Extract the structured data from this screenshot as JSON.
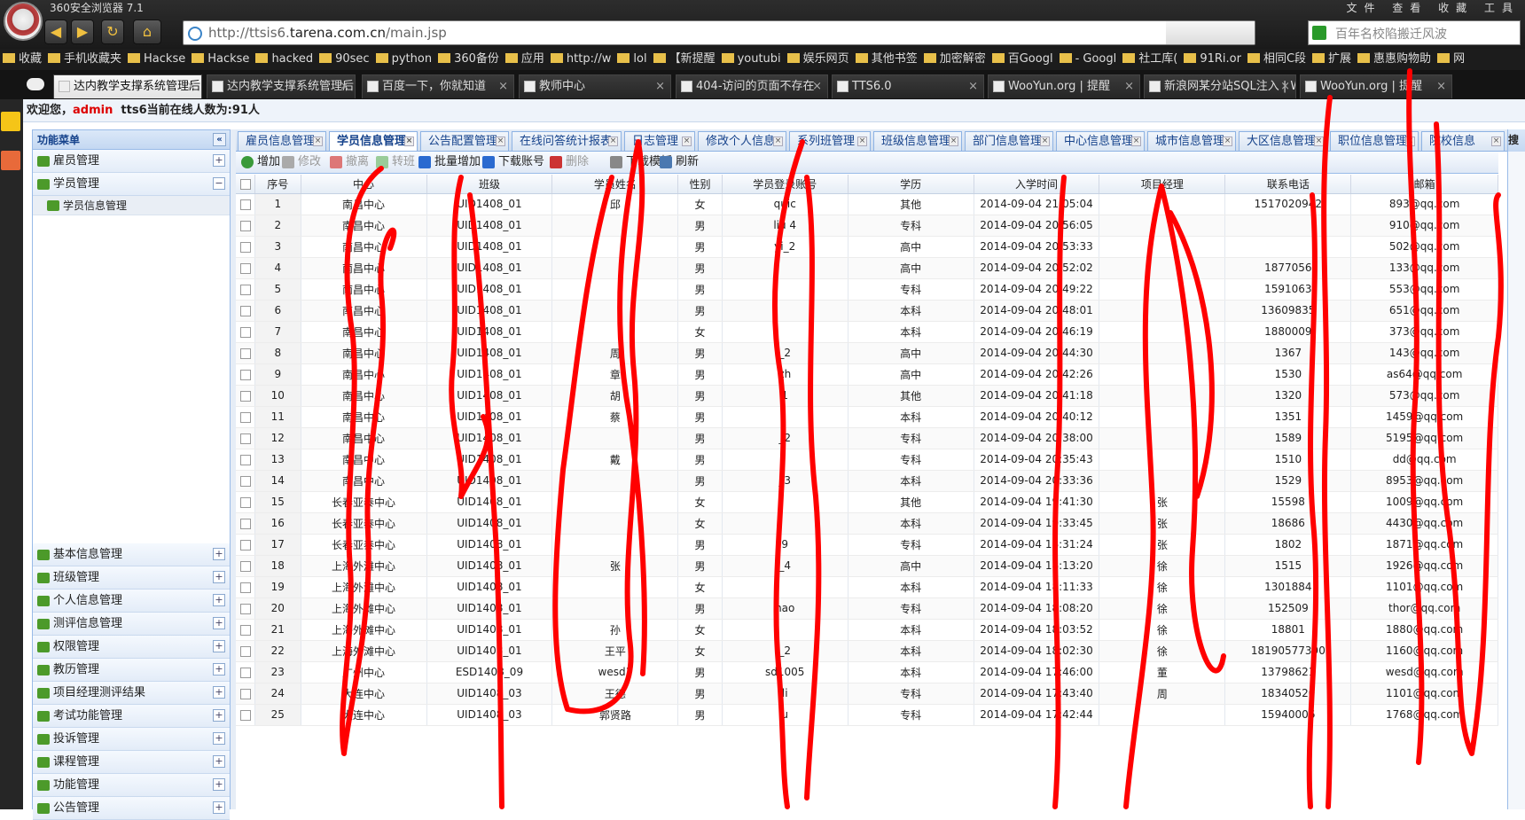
{
  "browser": {
    "title": "360安全浏览器 7.1",
    "menus": [
      "文件",
      "查看",
      "收藏",
      "工具"
    ],
    "url_prefix": "http://ttsis6.",
    "url_domain": "tarena.com.cn",
    "url_suffix": "/main.jsp",
    "search_placeholder": "百年名校陷搬迁风波"
  },
  "bookmarks": [
    "收藏",
    "手机收藏夹",
    "Hackse",
    "Hackse",
    "hacked",
    "90sec",
    "python",
    "360备份",
    "应用",
    "http://w",
    "lol",
    "【新提醒",
    "youtubi",
    "娱乐网页",
    "其他书签",
    "加密解密",
    "百Googl",
    "- Googl",
    "社工库(",
    "91Ri.or",
    "相同C段",
    "扩展",
    "惠惠购物助",
    "网"
  ],
  "tabs": [
    {
      "label": "达内教学支撑系统管理后台"
    },
    {
      "label": "达内教学支撑系统管理后台"
    },
    {
      "label": "百度一下，你就知道"
    },
    {
      "label": "教师中心"
    },
    {
      "label": "404-访问的页面不存在"
    },
    {
      "label": "TTS6.0"
    },
    {
      "label": "WooYun.org | 提醒"
    },
    {
      "label": "新浪网某分站SQL注入 | W"
    },
    {
      "label": "WooYun.org | 提醒"
    }
  ],
  "welcome": {
    "prefix": "欢迎您，",
    "user": "admin",
    "suffix": "tts6当前在线人数为:91人"
  },
  "sidebar": {
    "title": "功能菜单",
    "groups_top": [
      "雇员管理",
      "学员管理"
    ],
    "sub_item": "学员信息管理",
    "groups": [
      "基本信息管理",
      "班级管理",
      "个人信息管理",
      "测评信息管理",
      "权限管理",
      "教历管理",
      "项目经理测评结果",
      "考试功能管理",
      "投诉管理",
      "课程管理",
      "功能管理",
      "公告管理"
    ]
  },
  "page_tabs": [
    "雇员信息管理",
    "学员信息管理",
    "公告配置管理",
    "在线问答统计报表",
    "日志管理",
    "修改个人信息",
    "系列班管理",
    "班级信息管理",
    "部门信息管理",
    "中心信息管理",
    "城市信息管理",
    "大区信息管理",
    "职位信息管理",
    "院校信息"
  ],
  "toolbar": [
    "增加",
    "修改",
    "撤离",
    "转班",
    "批量增加",
    "下载账号",
    "删除",
    "下载模板",
    "刷新"
  ],
  "right_panel_title": "搜",
  "table": {
    "headers": [
      "序号",
      "中心",
      "班级",
      "学员姓名",
      "性别",
      "学员登录账号",
      "学历",
      "入学时间",
      "项目经理",
      "联系电话",
      "邮箱"
    ],
    "rows": [
      [
        "1",
        "南昌中心",
        "UID1408_01",
        "邱",
        "女",
        "quic",
        "其他",
        "2014-09-04 21:05:04",
        "",
        "1517020942",
        "893@qq.com"
      ],
      [
        "2",
        "南昌中心",
        "UID1408_01",
        "",
        "男",
        "liu 4",
        "专科",
        "2014-09-04 20:56:05",
        "",
        "",
        "910@qq.com"
      ],
      [
        "3",
        "南昌中心",
        "UID1408_01",
        "",
        "男",
        "yi_2",
        "高中",
        "2014-09-04 20:53:33",
        "",
        "",
        "502@qq.com"
      ],
      [
        "4",
        "南昌中心",
        "UID1408_01",
        "",
        "男",
        "",
        "高中",
        "2014-09-04 20:52:02",
        "",
        "1877056",
        "133@qq.com"
      ],
      [
        "5",
        "南昌中心",
        "UID1408_01",
        "",
        "男",
        "",
        "专科",
        "2014-09-04 20:49:22",
        "",
        "1591063",
        "553@qq.com"
      ],
      [
        "6",
        "南昌中心",
        "UID1408_01",
        "",
        "男",
        "",
        "本科",
        "2014-09-04 20:48:01",
        "",
        "13609835",
        "651@qq.com"
      ],
      [
        "7",
        "南昌中心",
        "UID1408_01",
        "",
        "女",
        "",
        "本科",
        "2014-09-04 20:46:19",
        "",
        "1880009",
        "373@qq.com"
      ],
      [
        "8",
        "南昌中心",
        "UID1408_01",
        "周",
        "男",
        "_2",
        "高中",
        "2014-09-04 20:44:30",
        "",
        "1367",
        "143@qq.com"
      ],
      [
        "9",
        "南昌中心",
        "UID1408_01",
        "章",
        "男",
        "zh",
        "高中",
        "2014-09-04 20:42:26",
        "",
        "1530",
        "as64@qq.com"
      ],
      [
        "10",
        "南昌中心",
        "UID1408_01",
        "胡",
        "男",
        "1",
        "其他",
        "2014-09-04 20:41:18",
        "",
        "1320",
        "573@qq.com"
      ],
      [
        "11",
        "南昌中心",
        "UID1408_01",
        "蔡",
        "男",
        "",
        "本科",
        "2014-09-04 20:40:12",
        "",
        "1351",
        "1459@qq.com"
      ],
      [
        "12",
        "南昌中心",
        "UID1408_01",
        "",
        "男",
        "_2",
        "专科",
        "2014-09-04 20:38:00",
        "",
        "1589",
        "5195@qq.com"
      ],
      [
        "13",
        "南昌中心",
        "UID1408_01",
        "戴",
        "男",
        "",
        "专科",
        "2014-09-04 20:35:43",
        "",
        "1510",
        "dd@qq.com"
      ],
      [
        "14",
        "南昌中心",
        "UID1408_01",
        "",
        "男",
        "_3",
        "本科",
        "2014-09-04 20:33:36",
        "",
        "1529",
        "8953@qq.com"
      ],
      [
        "15",
        "长春亚泰中心",
        "UID1408_01",
        "",
        "女",
        "",
        "其他",
        "2014-09-04 19:41:30",
        "张",
        "15598",
        "1009@qq.com"
      ],
      [
        "16",
        "长春亚泰中心",
        "UID1408_01",
        "",
        "女",
        "",
        "本科",
        "2014-09-04 19:33:45",
        "张",
        "18686",
        "4430@qq.com"
      ],
      [
        "17",
        "长春亚泰中心",
        "UID1408_01",
        "",
        "男",
        "9",
        "专科",
        "2014-09-04 18:31:24",
        "张",
        "1802",
        "1871@qq.com"
      ],
      [
        "18",
        "上海外滩中心",
        "UID1408_01",
        "张",
        "男",
        "_4",
        "高中",
        "2014-09-04 18:13:20",
        "徐",
        "1515",
        "1926@qq.com"
      ],
      [
        "19",
        "上海外滩中心",
        "UID1408_01",
        "",
        "女",
        "",
        "本科",
        "2014-09-04 18:11:33",
        "徐",
        "1301884",
        "1101@qq.com"
      ],
      [
        "20",
        "上海外滩中心",
        "UID1408_01",
        "",
        "男",
        "hao",
        "专科",
        "2014-09-04 18:08:20",
        "徐",
        "152509",
        "thor@qq.com"
      ],
      [
        "21",
        "上海外滩中心",
        "UID1408_01",
        "孙",
        "女",
        "",
        "本科",
        "2014-09-04 18:03:52",
        "徐",
        "18801",
        "1880@qq.com"
      ],
      [
        "22",
        "上海外滩中心",
        "UID1408_01",
        "王平",
        "女",
        "_2",
        "本科",
        "2014-09-04 18:02:30",
        "徐",
        "18190577390",
        "1160@qq.com"
      ],
      [
        "23",
        "广州中心",
        "ESD1408_09",
        "wesd1",
        "男",
        "sd1005",
        "本科",
        "2014-09-04 17:46:00",
        "董",
        "13798621",
        "wesd@qq.com"
      ],
      [
        "24",
        "大连中心",
        "UID1408_03",
        "王德",
        "男",
        "li",
        "专科",
        "2014-09-04 17:43:40",
        "周",
        "18340520",
        "1101@qq.com"
      ],
      [
        "25",
        "大连中心",
        "UID1408_03",
        "郭贤路",
        "男",
        "u",
        "专科",
        "2014-09-04 17:42:44",
        "",
        "15940006",
        "1768@qq.com"
      ]
    ]
  }
}
